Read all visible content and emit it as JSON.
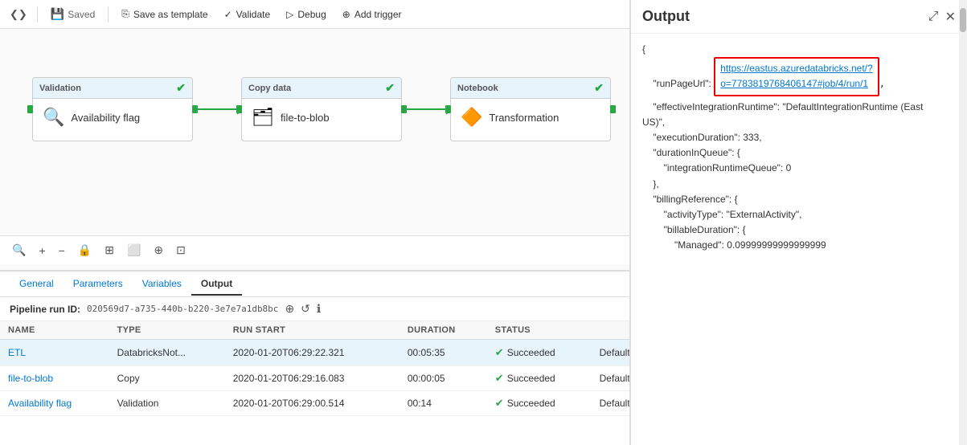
{
  "toolbar": {
    "saved_label": "Saved",
    "save_as_template_label": "Save as template",
    "validate_label": "Validate",
    "debug_label": "Debug",
    "add_trigger_label": "Add trigger",
    "code_label": "Code"
  },
  "pipeline": {
    "nodes": [
      {
        "id": "node1",
        "type": "Validation",
        "name": "Availability flag",
        "icon": "🔍"
      },
      {
        "id": "node2",
        "type": "Copy data",
        "name": "file-to-blob",
        "icon": "🗂"
      },
      {
        "id": "node3",
        "type": "Notebook",
        "name": "Transformation",
        "icon": "🔶"
      }
    ]
  },
  "canvas_toolbar": {
    "tools": [
      "🔍",
      "+",
      "−",
      "🔒",
      "⊞",
      "⬜",
      "⊕",
      "⊡"
    ]
  },
  "bottom_panel": {
    "tabs": [
      "General",
      "Parameters",
      "Variables",
      "Output"
    ],
    "active_tab": "Output",
    "pipeline_run_label": "Pipeline run ID:",
    "pipeline_run_id": "020569d7-a735-440b-b220-3e7e7a1db8bc",
    "table": {
      "headers": [
        "NAME",
        "TYPE",
        "RUN START",
        "DURATION",
        "STATUS"
      ],
      "rows": [
        {
          "name": "ETL",
          "type": "DatabricksNot...",
          "run_start": "2020-01-20T06:29:22.321",
          "duration": "00:05:35",
          "status": "Succeeded",
          "integration": "DefaultIntegrationRuntime (East US)",
          "active": true
        },
        {
          "name": "file-to-blob",
          "type": "Copy",
          "run_start": "2020-01-20T06:29:16.083",
          "duration": "00:00:05",
          "status": "Succeeded",
          "integration": "DefaultIntegrationRuntime (Central US)",
          "active": false
        },
        {
          "name": "Availability flag",
          "type": "Validation",
          "run_start": "2020-01-20T06:29:00.514",
          "duration": "00:14",
          "status": "Succeeded",
          "integration": "DefaultIntegrationRuntime (East US)",
          "active": false
        }
      ]
    }
  },
  "output_panel": {
    "title": "Output",
    "url_label": "https://eastus.azuredatabricks.net/?o=778381976840 6147#job/4/run/1",
    "url_display": "https://eastus.azuredatabricks.net/?o=7783819768406147#job/4/run/1",
    "content": "{\n    \"runPageUrl\": \"\",\n    \"effectiveIntegrationRuntime\": \"DefaultIntegrationRuntime (East\nUS)\",\n    \"executionDuration\": 333,\n    \"durationInQueue\": {\n        \"integrationRuntimeQueue\": 0\n    },\n    \"billingReference\": {\n        \"activityType\": \"ExternalActivity\",\n        \"billableDuration\": {\n            \"Managed\": 0.09999999999999999"
  }
}
